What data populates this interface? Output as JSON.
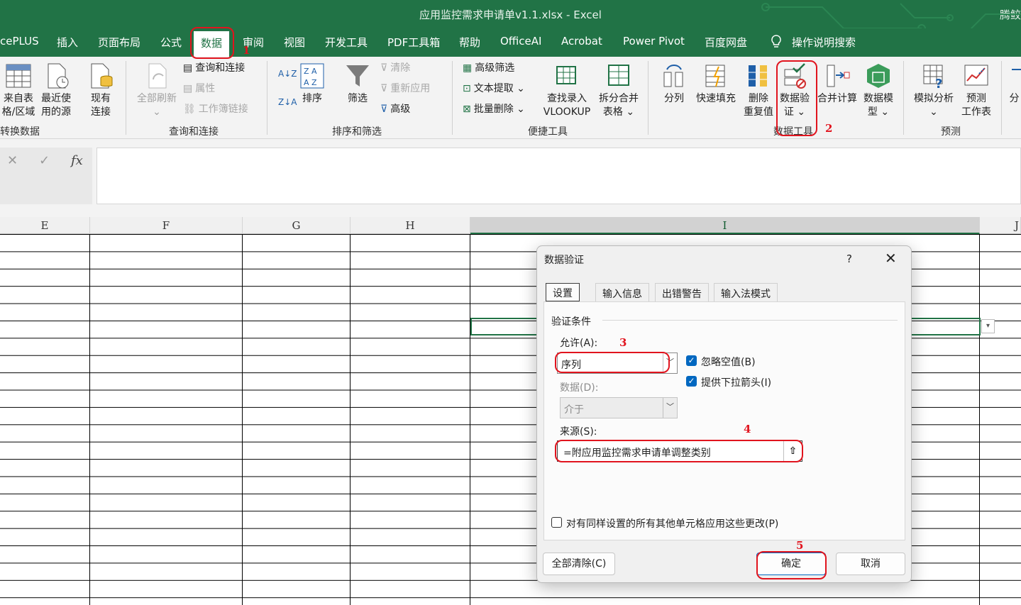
{
  "app": {
    "window_title": "应用监控需求申请单v1.1.xlsx  -  Excel",
    "user": "腾鲛"
  },
  "tabs": [
    {
      "label": "cePLUS"
    },
    {
      "label": "插入"
    },
    {
      "label": "页面布局"
    },
    {
      "label": "公式"
    },
    {
      "label": "数据",
      "active": true
    },
    {
      "label": "审阅"
    },
    {
      "label": "视图"
    },
    {
      "label": "开发工具"
    },
    {
      "label": "PDF工具箱"
    },
    {
      "label": "帮助"
    },
    {
      "label": "OfficeAI"
    },
    {
      "label": "Acrobat"
    },
    {
      "label": "Power Pivot"
    },
    {
      "label": "百度网盘"
    },
    {
      "label": "操作说明搜索"
    }
  ],
  "ribbon": {
    "groups": {
      "transform": "转换数据",
      "queries": "查询和连接",
      "sort_filter": "排序和筛选",
      "quick_tools": "便捷工具",
      "data_tools": "数据工具",
      "forecast": "预测"
    },
    "buttons": {
      "from_table_1": "来自表",
      "from_table_2": "格/区域",
      "recent_1": "最近使",
      "recent_2": "用的源",
      "existing_1": "现有",
      "existing_2": "连接",
      "refresh_all": "全部刷新",
      "query_conn": "查询和连接",
      "properties": "属性",
      "workbook_links": "工作簿链接",
      "sort": "排序",
      "filter": "筛选",
      "clear": "清除",
      "reapply": "重新应用",
      "advanced": "高级",
      "adv_filter": "高级筛选",
      "text_extract": "文本提取",
      "batch_delete": "批量删除",
      "lookup_1": "查找录入",
      "lookup_2": "VLOOKUP",
      "split_merge_1": "拆分合并",
      "split_merge_2": "表格",
      "text_to_cols": "分列",
      "flash_fill": "快速填充",
      "remove_dup_1": "删除",
      "remove_dup_2": "重复值",
      "validation_1": "数据验",
      "validation_2": "证",
      "consolidate": "合并计算",
      "data_model_1": "数据模",
      "data_model_2": "型",
      "whatif": "模拟分析",
      "forecast_1": "预测",
      "forecast_2": "工作表",
      "outline": "分"
    }
  },
  "formula_bar": {
    "cancel": "✕",
    "enter": "✓",
    "fx": "fx"
  },
  "columns": [
    {
      "label": "E"
    },
    {
      "label": "F"
    },
    {
      "label": "G"
    },
    {
      "label": "H"
    },
    {
      "label": "I",
      "selected": true
    },
    {
      "label": "J"
    }
  ],
  "dialog": {
    "title": "数据验证",
    "help": "?",
    "close": "✕",
    "tabs": [
      {
        "label": "设置",
        "active": true
      },
      {
        "label": "输入信息"
      },
      {
        "label": "出错警告"
      },
      {
        "label": "输入法模式"
      }
    ],
    "section": "验证条件",
    "allow_label": "允许(A):",
    "allow_value": "序列",
    "data_label": "数据(D):",
    "data_value": "介于",
    "ignore_blank_label": "忽略空值(B)",
    "ignore_blank_checked": true,
    "dropdown_label": "提供下拉箭头(I)",
    "dropdown_checked": true,
    "source_label": "来源(S):",
    "source_value": "=附应用监控需求申请单调整类别",
    "apply_all_label": "对有同样设置的所有其他单元格应用这些更改(P)",
    "apply_all_checked": false,
    "clear_all": "全部清除(C)",
    "ok": "确定",
    "cancel": "取消"
  },
  "annotations": [
    "1",
    "2",
    "3",
    "4",
    "5"
  ],
  "colors": {
    "excel_green": "#217346",
    "annotation_red": "#e1141e",
    "checkbox_blue": "#0067c0"
  }
}
